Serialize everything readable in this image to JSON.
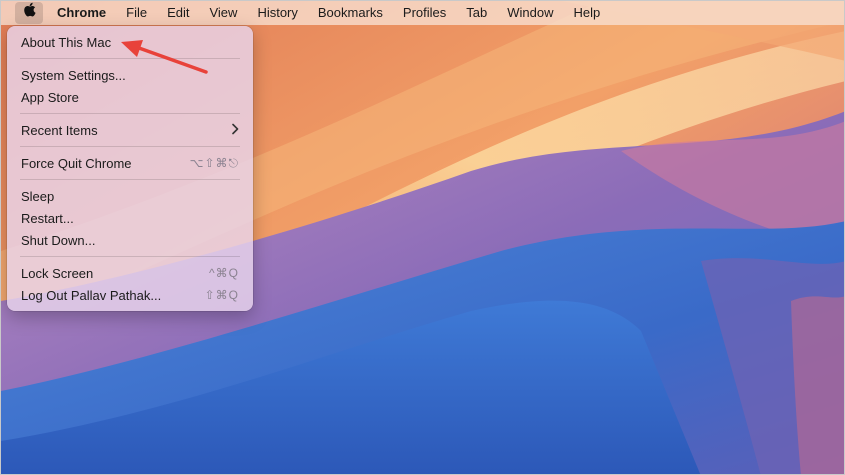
{
  "menubar": {
    "apple_icon": "apple-logo-icon",
    "items": [
      {
        "label": "Chrome",
        "bold": true
      },
      {
        "label": "File"
      },
      {
        "label": "Edit"
      },
      {
        "label": "View"
      },
      {
        "label": "History"
      },
      {
        "label": "Bookmarks"
      },
      {
        "label": "Profiles"
      },
      {
        "label": "Tab"
      },
      {
        "label": "Window"
      },
      {
        "label": "Help"
      }
    ]
  },
  "apple_menu": {
    "about": "About This Mac",
    "system_settings": "System Settings...",
    "app_store": "App Store",
    "recent_items": "Recent Items",
    "force_quit": "Force Quit Chrome",
    "force_quit_shortcut": "⌥⇧⌘⎋",
    "sleep": "Sleep",
    "restart": "Restart...",
    "shut_down": "Shut Down...",
    "lock_screen": "Lock Screen",
    "lock_screen_shortcut": "^⌘Q",
    "log_out": "Log Out Pallav Pathak...",
    "log_out_shortcut": "⇧⌘Q"
  },
  "annotation": {
    "arrow_color": "#e8423a"
  }
}
